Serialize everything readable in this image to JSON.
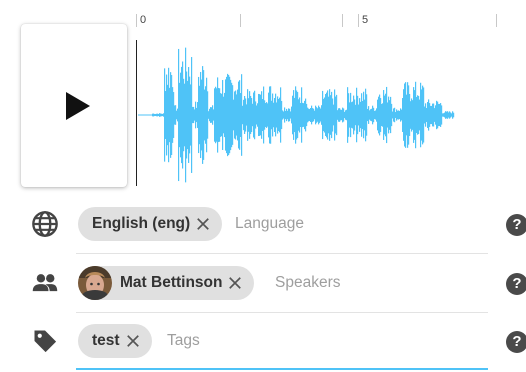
{
  "player": {
    "play_icon": "play-icon"
  },
  "timeline": {
    "tick_labels": [
      "0",
      "5"
    ]
  },
  "waveform": {
    "color": "#4fc3f7",
    "icon": "waveform"
  },
  "fields": {
    "language": {
      "icon": "globe-icon",
      "chip_label": "English (eng)",
      "placeholder": "Language",
      "help": "?"
    },
    "speakers": {
      "icon": "people-icon",
      "chip_label": "Mat Bettinson",
      "placeholder": "Speakers",
      "help": "?"
    },
    "tags": {
      "icon": "tag-icon",
      "chip_label": "test",
      "placeholder": "Tags",
      "help": "?"
    }
  },
  "accent": "#4fc3f7"
}
